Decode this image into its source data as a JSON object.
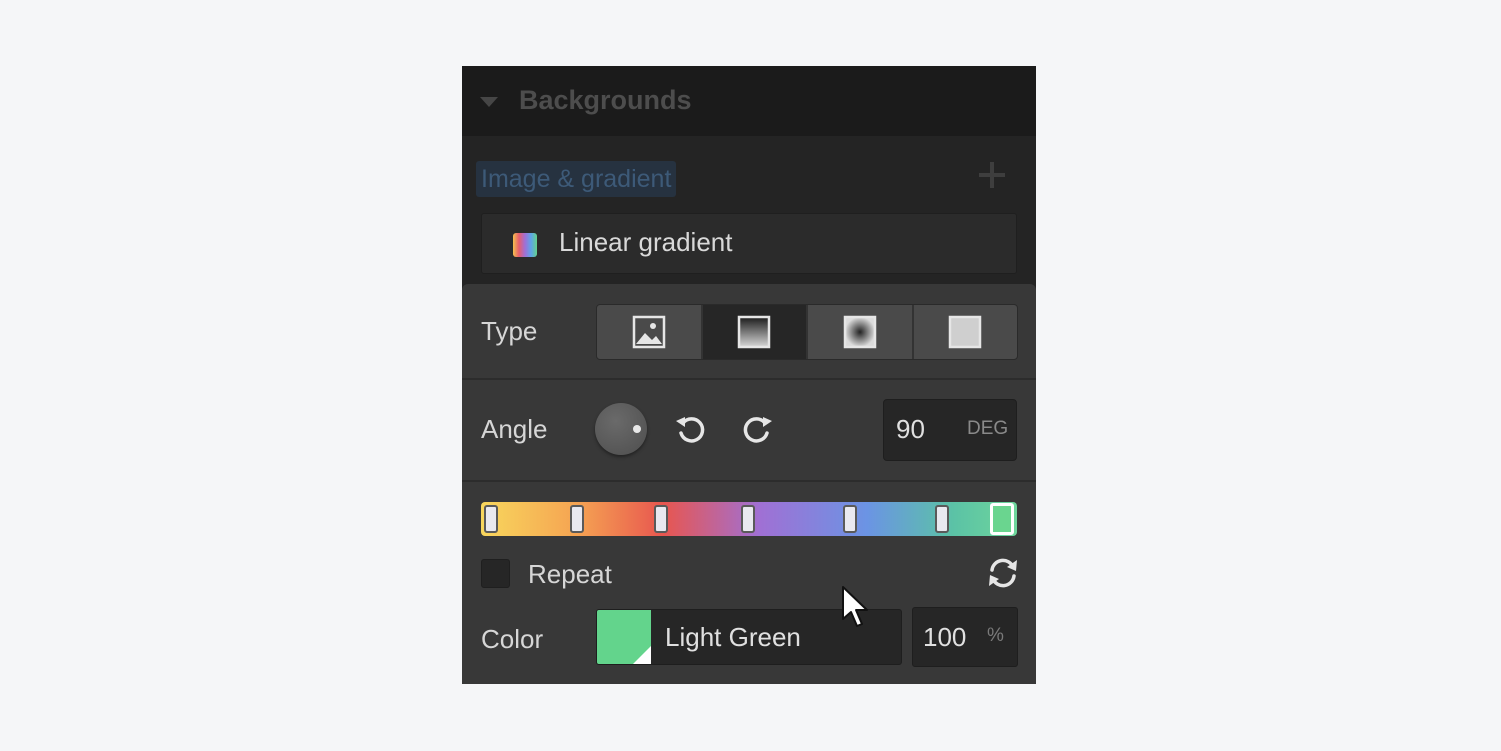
{
  "panel": {
    "section_title": "Backgrounds",
    "image_gradient_label": "Image & gradient",
    "layer_label": "Linear gradient"
  },
  "editor": {
    "type_label": "Type",
    "type_options": [
      "image-icon",
      "linear-gradient-icon",
      "radial-gradient-icon",
      "solid-color-icon"
    ],
    "type_selected_index": 1,
    "angle_label": "Angle",
    "angle_value": "90",
    "angle_unit": "DEG",
    "gradient_stops": [
      "#f8d75d",
      "#f5a352",
      "#e8564f",
      "#a070d4",
      "#6b94e4",
      "#5bc2a6",
      "#6ed69b"
    ],
    "selected_stop_index": 6,
    "repeat_label": "Repeat",
    "color_label": "Color",
    "color_name": "Light Green",
    "color_hex": "#63d48c",
    "opacity_value": "100",
    "opacity_unit": "%"
  }
}
